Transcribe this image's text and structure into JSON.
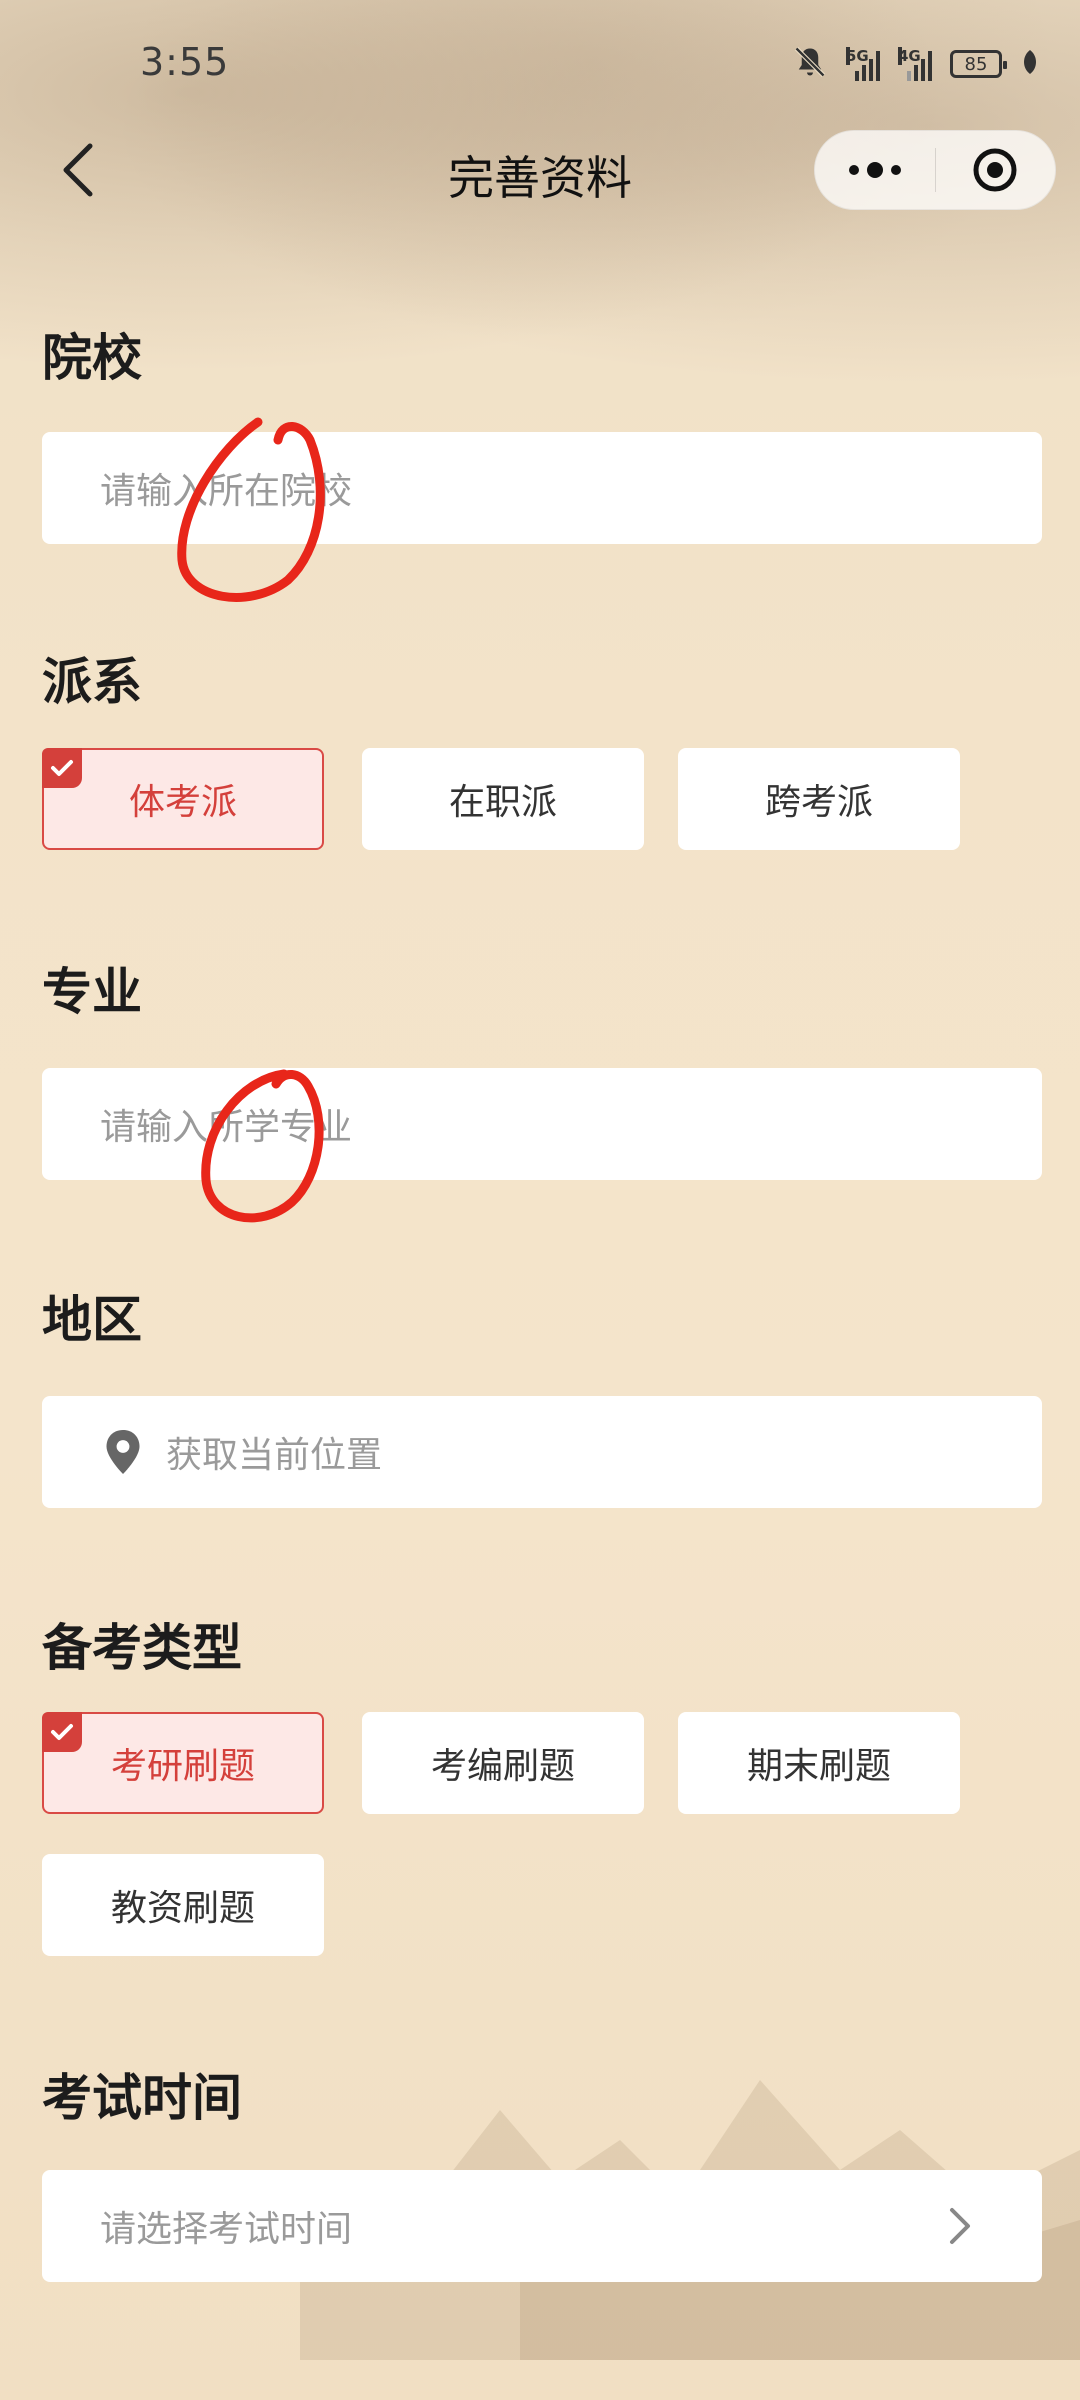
{
  "status_bar": {
    "time": "3:55",
    "network_1": "5G",
    "network_2": "4G",
    "battery": "85"
  },
  "nav": {
    "title": "完善资料"
  },
  "sections": {
    "school": {
      "title": "院校",
      "placeholder": "请输入所在院校"
    },
    "faction": {
      "title": "派系",
      "options": [
        {
          "label": "体考派",
          "selected": true
        },
        {
          "label": "在职派",
          "selected": false
        },
        {
          "label": "跨考派",
          "selected": false
        }
      ]
    },
    "major": {
      "title": "专业",
      "placeholder": "请输入所学专业"
    },
    "region": {
      "title": "地区",
      "placeholder": "获取当前位置"
    },
    "exam_type": {
      "title": "备考类型",
      "options": [
        {
          "label": "考研刷题",
          "selected": true
        },
        {
          "label": "考编刷题",
          "selected": false
        },
        {
          "label": "期末刷题",
          "selected": false
        },
        {
          "label": "教资刷题",
          "selected": false
        }
      ]
    },
    "exam_time": {
      "title": "考试时间",
      "placeholder": "请选择考试时间"
    }
  },
  "colors": {
    "accent": "#d4403b",
    "selected_bg": "#fde8e6",
    "background": "#f3e3c9",
    "annotation": "#e8261a"
  },
  "icons": {
    "back": "chevron-left-icon",
    "more": "more-dots-icon",
    "close": "target-close-icon",
    "location": "location-pin-icon",
    "chevron": "chevron-right-icon",
    "check": "check-icon",
    "mute": "bell-mute-icon"
  }
}
